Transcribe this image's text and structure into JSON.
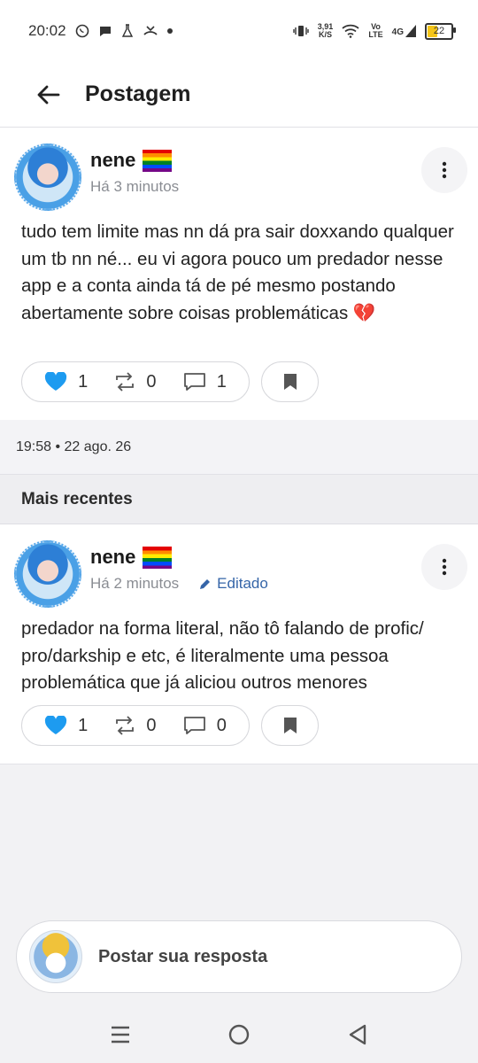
{
  "status_bar": {
    "time": "20:02",
    "net_speed_top": "3,91",
    "net_speed_bottom": "K/S",
    "volte_top": "Vo",
    "volte_bottom": "LTE",
    "network": "4G",
    "battery": "22",
    "battery_color": "#f5c518"
  },
  "header": {
    "title": "Postagem"
  },
  "post1": {
    "author": "nene",
    "time": "Há 3 minutos",
    "text": "tudo tem limite mas nn dá pra sair doxxando qualquer um tb nn né... eu vi agora pouco um predador nesse app e a conta ainda tá de pé mesmo postando abertamente sobre coisas problemáticas 💔",
    "likes": "1",
    "reposts": "0",
    "comments": "1"
  },
  "date_line": "19:58 • 22 ago. 26",
  "section_title": "Mais recentes",
  "post2": {
    "author": "nene",
    "time": "Há 2 minutos",
    "edited": "Editado",
    "text": "predador na forma literal, não tô falando de profic/ pro/darkship e etc, é literalmente uma pessoa problemática que já aliciou outros menores",
    "likes": "1",
    "reposts": "0",
    "comments": "0"
  },
  "reply": {
    "placeholder": "Postar sua resposta"
  },
  "colors": {
    "like_blue": "#1d9bf0",
    "edited_blue": "#3565a8"
  },
  "icons": [
    "arrow-left-icon",
    "more-vert-icon",
    "heart-icon",
    "repost-icon",
    "comment-icon",
    "bookmark-icon",
    "pencil-icon",
    "menu-icon",
    "home-circle-icon",
    "back-triangle-icon"
  ]
}
